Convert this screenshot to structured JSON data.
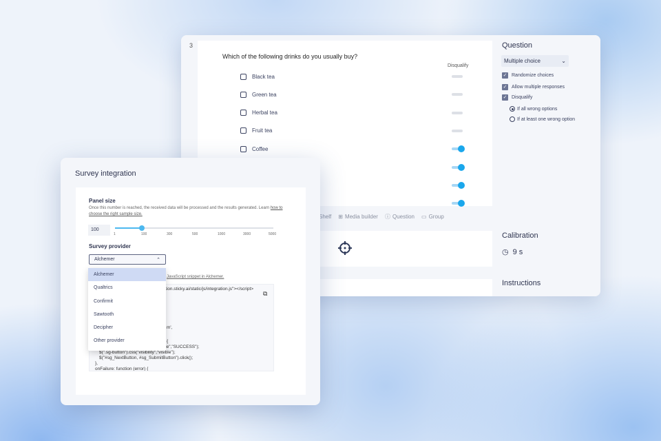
{
  "question": {
    "number": "3",
    "title": "Which of the following drinks do you usually buy?",
    "disqualify_label": "Disqualify",
    "options": [
      {
        "label": "Black tea",
        "disqualify": false
      },
      {
        "label": "Green tea",
        "disqualify": false
      },
      {
        "label": "Herbal tea",
        "disqualify": false
      },
      {
        "label": "Fruit tea",
        "disqualify": false
      },
      {
        "label": "Coffee",
        "disqualify": true
      },
      {
        "label": "",
        "disqualify": true
      },
      {
        "label": "",
        "disqualify": true
      },
      {
        "label": "",
        "disqualify": true
      }
    ]
  },
  "toolbar": [
    "Shelf",
    "Media builder",
    "Question",
    "Group"
  ],
  "right_panel": {
    "title": "Question",
    "type": "Multiple choice",
    "checks": [
      "Randomize choices",
      "Allow multiple responses",
      "Disqualify"
    ],
    "radios": [
      "If all wrong options",
      "If at least one wrong option"
    ],
    "calibration_title": "Calibration",
    "calibration_value": "9 s",
    "instructions_title": "Instructions"
  },
  "integration": {
    "title": "Survey integration",
    "panel_size_label": "Panel size",
    "panel_desc": "Once this number is reached, the received data will be processed and the results generated. Learn ",
    "panel_link1": "how to",
    "panel_link2": "choose the right sample size.",
    "panel_value": "100",
    "ticks": [
      "1",
      "100",
      "300",
      "500",
      "1000",
      "3000",
      "5000"
    ],
    "slider_value": 100,
    "provider_label": "Survey provider",
    "provider_value": "Alchemer",
    "snippet_link": "JavaScript snippet in Alchemer.",
    "providers": [
      "Alchemer",
      "Qualtrics",
      "Confirmit",
      "Sawtooth",
      "Decipher",
      "Other provider"
    ],
    "code": [
      "tion.sticky.ai/static/js/integration.js\"></script>",
      "m',",
      "{",
      "alue\",\"SUCCESS\");",
      "$(\".sg-button\").css(\"visibility\",\"visible\");",
      "$(\"#sg_NextButton, #sg_SubmitButton\").click();",
      "},",
      "onFailure: function (error) {"
    ]
  }
}
